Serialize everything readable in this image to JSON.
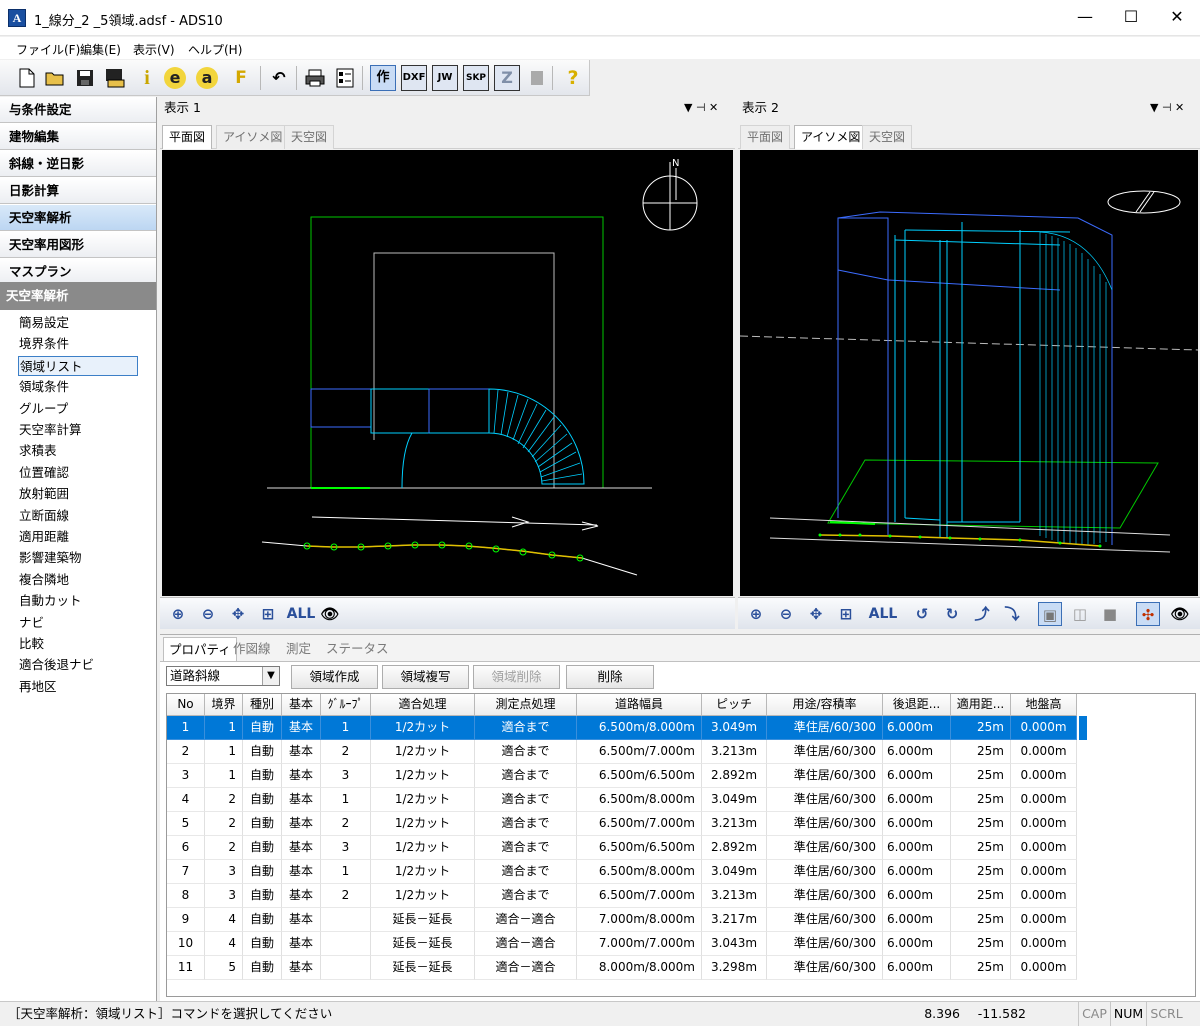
{
  "window": {
    "title": "1_線分_2 _5領域.adsf - ADS10",
    "icon_letter": "A",
    "min": "—",
    "max": "☐",
    "close": "✕"
  },
  "menu": [
    {
      "label": "ファイル(F)"
    },
    {
      "label": "編集(E)"
    },
    {
      "label": "表示(V)"
    },
    {
      "label": "ヘルプ(H)"
    }
  ],
  "toolbar": {
    "info": "i",
    "e": "e",
    "a": "a",
    "f": "F",
    "draw": "作",
    "dxf": "DXF",
    "jw": "JW",
    "skp": "SKP",
    "z": "Z",
    "help": "?"
  },
  "categories": [
    {
      "label": "与条件設定"
    },
    {
      "label": "建物編集"
    },
    {
      "label": "斜線・逆日影"
    },
    {
      "label": "日影計算"
    },
    {
      "label": "天空率解析"
    },
    {
      "label": "天空率用図形"
    },
    {
      "label": "マスプラン"
    }
  ],
  "commands_header": "天空率解析",
  "commands": [
    "簡易設定",
    "境界条件",
    "領域リスト",
    "領域条件",
    "グループ",
    "天空率計算",
    "求積表",
    "位置確認",
    "放射範囲",
    "立断面線",
    "適用距離",
    "影響建築物",
    "複合隣地",
    "自動カット",
    "ナビ",
    "比較",
    "適合後退ナビ",
    "再地区"
  ],
  "view1": {
    "title": "表示 1",
    "tabs": [
      "平面図",
      "アイソメ図",
      "天空図"
    ],
    "active_tab": 0,
    "pin": "▼  ⊣  ✕",
    "all_label": "ALL"
  },
  "view2": {
    "title": "表示 2",
    "tabs": [
      "平面図",
      "アイソメ図",
      "天空図"
    ],
    "active_tab": 1,
    "pin": "▼  ⊣  ✕",
    "all_label": "ALL"
  },
  "bottom": {
    "tabs": [
      "プロパティ",
      "作図線",
      "測定",
      "ステータス"
    ],
    "active_tab": 0,
    "combo_value": "道路斜線",
    "buttons": {
      "create": "領域作成",
      "copy": "領域複写",
      "delete_area": "領域削除",
      "delete": "削除"
    },
    "columns": [
      "No",
      "境界",
      "種別",
      "基本",
      "ｸﾞﾙｰﾌﾟ",
      "適合処理",
      "測定点処理",
      "道路幅員",
      "ピッチ",
      "用途/容積率",
      "後退距...",
      "適用距...",
      "地盤高"
    ],
    "rows": [
      [
        "1",
        "1",
        "自動",
        "基本",
        "1",
        "1/2カット",
        "適合まで",
        "6.500m/8.000m",
        "3.049m",
        "準住居/60/300",
        "6.000m",
        "25m",
        "0.000m"
      ],
      [
        "2",
        "1",
        "自動",
        "基本",
        "2",
        "1/2カット",
        "適合まで",
        "6.500m/7.000m",
        "3.213m",
        "準住居/60/300",
        "6.000m",
        "25m",
        "0.000m"
      ],
      [
        "3",
        "1",
        "自動",
        "基本",
        "3",
        "1/2カット",
        "適合まで",
        "6.500m/6.500m",
        "2.892m",
        "準住居/60/300",
        "6.000m",
        "25m",
        "0.000m"
      ],
      [
        "4",
        "2",
        "自動",
        "基本",
        "1",
        "1/2カット",
        "適合まで",
        "6.500m/8.000m",
        "3.049m",
        "準住居/60/300",
        "6.000m",
        "25m",
        "0.000m"
      ],
      [
        "5",
        "2",
        "自動",
        "基本",
        "2",
        "1/2カット",
        "適合まで",
        "6.500m/7.000m",
        "3.213m",
        "準住居/60/300",
        "6.000m",
        "25m",
        "0.000m"
      ],
      [
        "6",
        "2",
        "自動",
        "基本",
        "3",
        "1/2カット",
        "適合まで",
        "6.500m/6.500m",
        "2.892m",
        "準住居/60/300",
        "6.000m",
        "25m",
        "0.000m"
      ],
      [
        "7",
        "3",
        "自動",
        "基本",
        "1",
        "1/2カット",
        "適合まで",
        "6.500m/8.000m",
        "3.049m",
        "準住居/60/300",
        "6.000m",
        "25m",
        "0.000m"
      ],
      [
        "8",
        "3",
        "自動",
        "基本",
        "2",
        "1/2カット",
        "適合まで",
        "6.500m/7.000m",
        "3.213m",
        "準住居/60/300",
        "6.000m",
        "25m",
        "0.000m"
      ],
      [
        "9",
        "4",
        "自動",
        "基本",
        "",
        "延長－延長",
        "適合－適合",
        "7.000m/8.000m",
        "3.217m",
        "準住居/60/300",
        "6.000m",
        "25m",
        "0.000m"
      ],
      [
        "10",
        "4",
        "自動",
        "基本",
        "",
        "延長－延長",
        "適合－適合",
        "7.000m/7.000m",
        "3.043m",
        "準住居/60/300",
        "6.000m",
        "25m",
        "0.000m"
      ],
      [
        "11",
        "5",
        "自動",
        "基本",
        "",
        "延長－延長",
        "適合－適合",
        "8.000m/8.000m",
        "3.298m",
        "準住居/60/300",
        "6.000m",
        "25m",
        "0.000m"
      ]
    ],
    "selected_row": 0
  },
  "status": {
    "message": "［天空率解析：領域リスト］コマンドを選択してください",
    "x": "8.396",
    "y": "-11.582",
    "cap": "CAP",
    "num": "NUM",
    "scrl": "SCRL"
  }
}
